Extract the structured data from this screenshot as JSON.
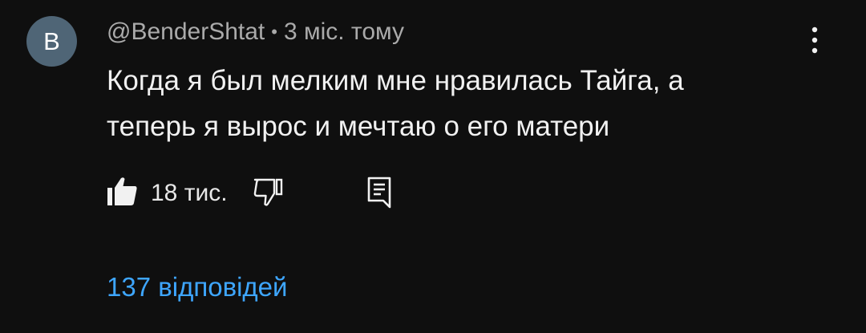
{
  "comment": {
    "avatar_letter": "B",
    "author": "@BenderShtat",
    "separator": "•",
    "time": "3 міс. тому",
    "text": "Когда я был мелким мне нравилась Тайга, а\nтеперь я вырос и мечтаю о его матери"
  },
  "actions": {
    "like_count": "18 тис."
  },
  "replies": {
    "label": "137 відповідей"
  },
  "colors": {
    "background": "#0f0f0f",
    "avatar": "#4f6576",
    "text_primary": "#f1f1f1",
    "text_secondary": "#aaaaaa",
    "link": "#3ea6ff"
  },
  "icons": {
    "like": "thumb-up-icon",
    "dislike": "thumb-down-icon",
    "reply": "reply-icon",
    "menu": "more-vertical-icon"
  }
}
